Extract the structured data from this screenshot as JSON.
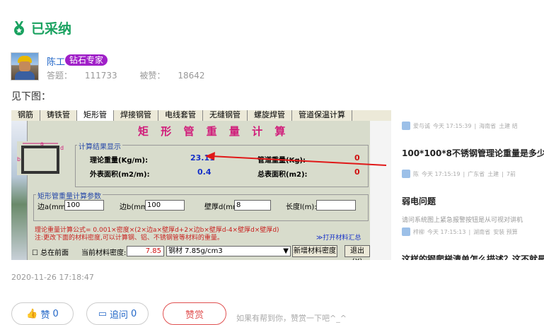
{
  "status": {
    "label": "已采纳",
    "color": "#1aa260"
  },
  "answerer": {
    "name": "陈工",
    "badge": "钻石专家",
    "answers_label": "答题：",
    "answers": "111733",
    "liked_label": "被赞：",
    "liked": "18642"
  },
  "intro_text": "见下图：",
  "embedded": {
    "tabs": [
      "钢筋",
      "铸铁管",
      "矩形管",
      "焊接钢管",
      "电线套管",
      "无缝钢管",
      "螺旋焊管",
      "管道保温计算"
    ],
    "active_tab": 2,
    "title": "矩 形 管 重 量 计 算",
    "diagram_labels": {
      "a": "a",
      "b": "b",
      "d": "d"
    },
    "result_group": "计算结果显示",
    "theory_weight_label": "理论重量(Kg/m):",
    "theory_weight_value": "23.11",
    "pipe_weight_label": "管道重量(Kg):",
    "pipe_weight_value": "0",
    "outer_area_label": "外表面积(m2/m):",
    "outer_area_value": "0.4",
    "total_area_label": "总表面积(m2):",
    "total_area_value": "0",
    "param_group": "矩形管重量计算参数",
    "side_a_label": "边a(mm):",
    "side_a_value": "100",
    "side_b_label": "边b(mm):",
    "side_b_value": "100",
    "wall_label": "壁厚d(mm):",
    "wall_value": "8",
    "length_label": "长度l(m):",
    "length_value": "",
    "formula": "理论重量计算公式= 0.001×密度×(2×边a×壁厚d+2×边b×壁厚d-4×壁厚d×壁厚d)",
    "note": "注:更改下面的材料密度,可以计算钢、铝、不锈钢管等材料的重量。",
    "open_summary": "≫打开材料汇总",
    "front_label": "总在前面",
    "density_label": "当前材料密度:",
    "density_value": "7.85",
    "material_select": "钢材 7.85g/cm3",
    "add_density_btn": "新增材料密度",
    "exit_btn": "退出(X)"
  },
  "feed": [
    {
      "user": "爱与诚",
      "time": "今天 17:15:39",
      "region": "海南省",
      "tags": "土建 结",
      "title": "",
      "desc": ""
    },
    {
      "user": "陈",
      "time": "今天 17:15:19",
      "region": "广东省",
      "tags": "土建",
      "title": "100*100*8不锈钢管理论重量是多少",
      "desc": "",
      "extra": "7前"
    },
    {
      "user": "梓柳",
      "time": "今天 17:15:13",
      "region": "湖南省",
      "tags": "安装 预算",
      "title": "弱电问题",
      "desc": "请问系统图上紧急报警按钮是从可视对讲机"
    },
    {
      "user": "",
      "time": "",
      "region": "",
      "tags": "",
      "title": "这样的钢爬梯清单怎么描述？这不就是",
      "desc": ""
    }
  ],
  "date": "2020-11-26 17:18:47",
  "actions": {
    "like_label": "赞",
    "like_count": "0",
    "ask_label": "追问",
    "ask_count": "0",
    "reward_label": "赞赏",
    "hint": "如果有帮到你，赞赏一下吧^_^"
  }
}
